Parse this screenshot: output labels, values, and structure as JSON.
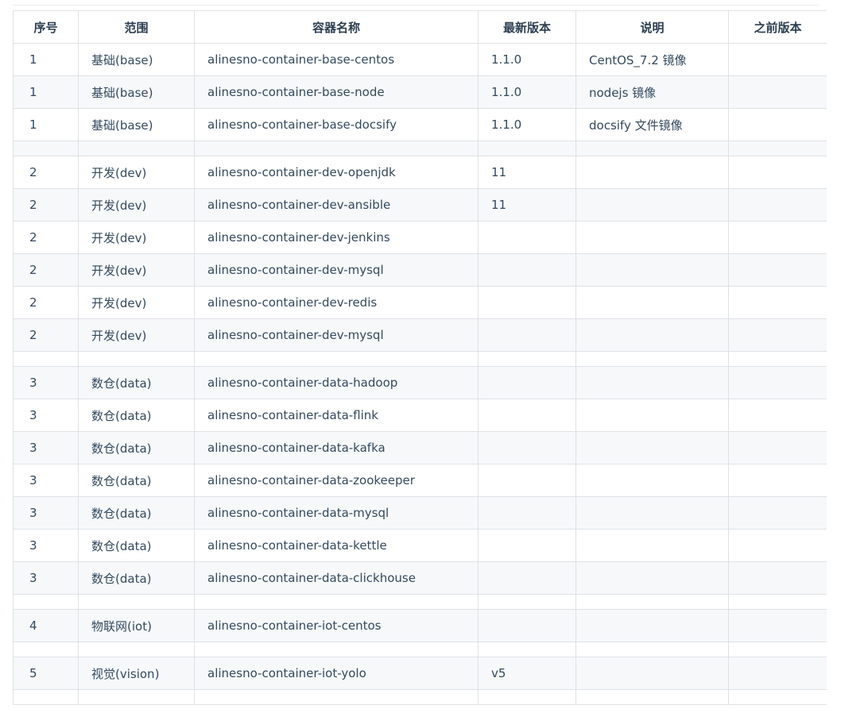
{
  "headers": [
    "序号",
    "范围",
    "容器名称",
    "最新版本",
    "说明",
    "之前版本"
  ],
  "rows": [
    {
      "no": "1",
      "scope": "基础(base)",
      "name": "alinesno-container-base-centos",
      "latest": "1.1.0",
      "desc": "CentOS_7.2 镜像",
      "prev": ""
    },
    {
      "no": "1",
      "scope": "基础(base)",
      "name": "alinesno-container-base-node",
      "latest": "1.1.0",
      "desc": "nodejs 镜像",
      "prev": ""
    },
    {
      "no": "1",
      "scope": "基础(base)",
      "name": "alinesno-container-base-docsify",
      "latest": "1.1.0",
      "desc": "docsify 文件镜像",
      "prev": ""
    },
    {
      "no": "",
      "scope": "",
      "name": "",
      "latest": "",
      "desc": "",
      "prev": ""
    },
    {
      "no": "2",
      "scope": "开发(dev)",
      "name": "alinesno-container-dev-openjdk",
      "latest": "11",
      "desc": "",
      "prev": ""
    },
    {
      "no": "2",
      "scope": "开发(dev)",
      "name": "alinesno-container-dev-ansible",
      "latest": "11",
      "desc": "",
      "prev": ""
    },
    {
      "no": "2",
      "scope": "开发(dev)",
      "name": "alinesno-container-dev-jenkins",
      "latest": "",
      "desc": "",
      "prev": ""
    },
    {
      "no": "2",
      "scope": "开发(dev)",
      "name": "alinesno-container-dev-mysql",
      "latest": "",
      "desc": "",
      "prev": ""
    },
    {
      "no": "2",
      "scope": "开发(dev)",
      "name": "alinesno-container-dev-redis",
      "latest": "",
      "desc": "",
      "prev": ""
    },
    {
      "no": "2",
      "scope": "开发(dev)",
      "name": "alinesno-container-dev-mysql",
      "latest": "",
      "desc": "",
      "prev": ""
    },
    {
      "no": "",
      "scope": "",
      "name": "",
      "latest": "",
      "desc": "",
      "prev": ""
    },
    {
      "no": "3",
      "scope": "数仓(data)",
      "name": "alinesno-container-data-hadoop",
      "latest": "",
      "desc": "",
      "prev": ""
    },
    {
      "no": "3",
      "scope": "数仓(data)",
      "name": "alinesno-container-data-flink",
      "latest": "",
      "desc": "",
      "prev": ""
    },
    {
      "no": "3",
      "scope": "数仓(data)",
      "name": "alinesno-container-data-kafka",
      "latest": "",
      "desc": "",
      "prev": ""
    },
    {
      "no": "3",
      "scope": "数仓(data)",
      "name": "alinesno-container-data-zookeeper",
      "latest": "",
      "desc": "",
      "prev": ""
    },
    {
      "no": "3",
      "scope": "数仓(data)",
      "name": "alinesno-container-data-mysql",
      "latest": "",
      "desc": "",
      "prev": ""
    },
    {
      "no": "3",
      "scope": "数仓(data)",
      "name": "alinesno-container-data-kettle",
      "latest": "",
      "desc": "",
      "prev": ""
    },
    {
      "no": "3",
      "scope": "数仓(data)",
      "name": "alinesno-container-data-clickhouse",
      "latest": "",
      "desc": "",
      "prev": ""
    },
    {
      "no": "",
      "scope": "",
      "name": "",
      "latest": "",
      "desc": "",
      "prev": ""
    },
    {
      "no": "4",
      "scope": "物联网(iot)",
      "name": "alinesno-container-iot-centos",
      "latest": "",
      "desc": "",
      "prev": ""
    },
    {
      "no": "",
      "scope": "",
      "name": "",
      "latest": "",
      "desc": "",
      "prev": ""
    },
    {
      "no": "5",
      "scope": "视觉(vision)",
      "name": "alinesno-container-iot-yolo",
      "latest": "v5",
      "desc": "",
      "prev": ""
    },
    {
      "no": "",
      "scope": "",
      "name": "",
      "latest": "",
      "desc": "",
      "prev": ""
    }
  ]
}
